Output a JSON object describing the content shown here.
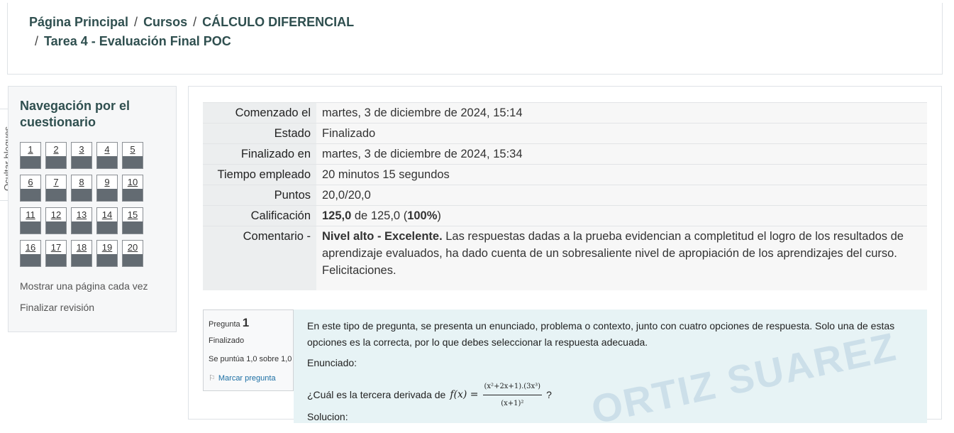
{
  "breadcrumb": {
    "home": "Página Principal",
    "courses": "Cursos",
    "course": "CÁLCULO DIFERENCIAL",
    "activity": "Tarea 4 - Evaluación Final POC",
    "separator": "/"
  },
  "hide_blocks": "Ocultar bloques",
  "nav": {
    "title": "Navegación por el cuestionario",
    "questions": [
      "1",
      "2",
      "3",
      "4",
      "5",
      "6",
      "7",
      "8",
      "9",
      "10",
      "11",
      "12",
      "13",
      "14",
      "15",
      "16",
      "17",
      "18",
      "19",
      "20"
    ],
    "show_one_page": "Mostrar una página cada vez",
    "finish_review": "Finalizar revisión"
  },
  "summary": {
    "started_label": "Comenzado el",
    "started_value": "martes, 3 de diciembre de 2024, 15:14",
    "state_label": "Estado",
    "state_value": "Finalizado",
    "finished_label": "Finalizado en",
    "finished_value": "martes, 3 de diciembre de 2024, 15:34",
    "time_label": "Tiempo empleado",
    "time_value": "20 minutos 15 segundos",
    "points_label": "Puntos",
    "points_value": "20,0/20,0",
    "grade_label": "Calificación",
    "grade_bold": "125,0",
    "grade_rest": " de 125,0 (",
    "grade_percent": "100%",
    "grade_close": ")",
    "comment_label": "Comentario -",
    "comment_bold": "Nivel alto - Excelente.",
    "comment_text": " Las respuestas dadas a la prueba evidencian a completitud el logro de los resultados de aprendizaje evaluados, ha dado cuenta de un sobresaliente nivel de apropiación de los aprendizajes del curso. Felicitaciones."
  },
  "question": {
    "label": "Pregunta",
    "number": "1",
    "state": "Finalizado",
    "score": "Se puntúa 1,0 sobre 1,0",
    "flag": "Marcar pregunta",
    "intro": "En este tipo de pregunta, se presenta un enunciado, problema o contexto, junto con cuatro opciones de respuesta. Solo una de estas opciones es la correcta, por lo que debes seleccionar la respuesta adecuada.",
    "enunciado": "Enunciado:",
    "prompt": "¿Cuál es la tercera derivada de",
    "func": "f(x) =",
    "numerator": "(x²+2x+1).(3x³)",
    "denominator": "(x+1)²",
    "end": "?",
    "solucion": "Solucion:"
  },
  "watermark": "ORTIZ SUAREZ"
}
